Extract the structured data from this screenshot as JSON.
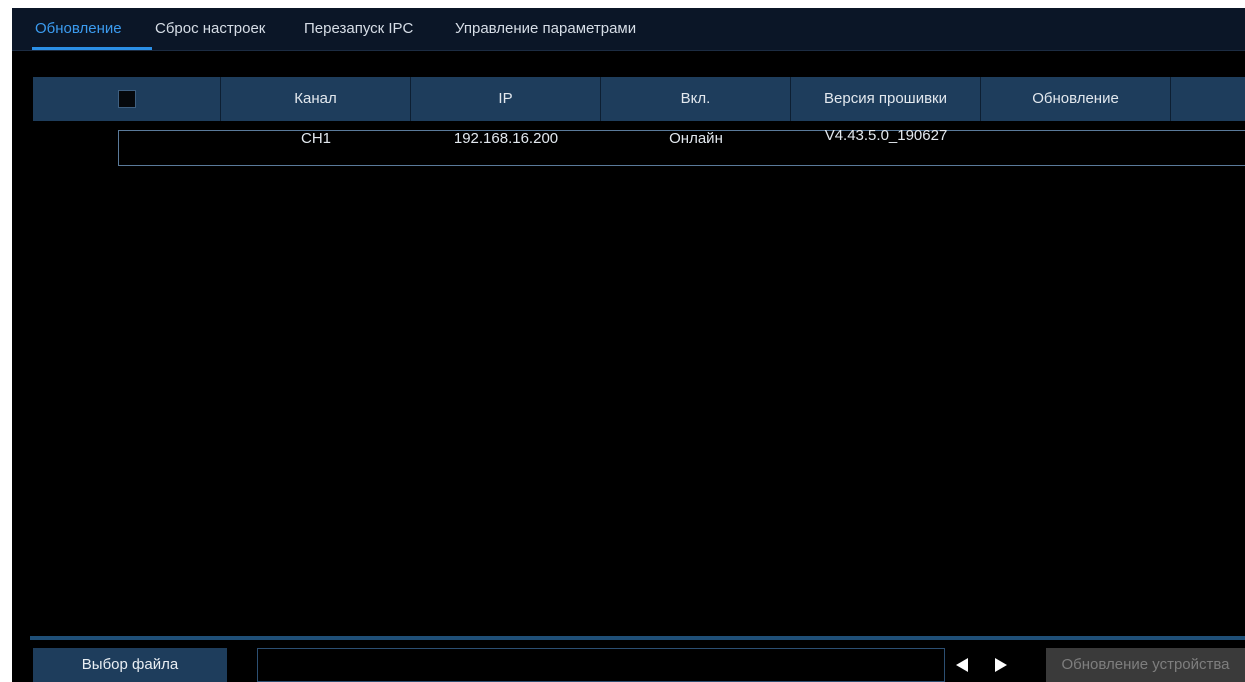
{
  "tabs": [
    {
      "label": "Обновление",
      "active": true
    },
    {
      "label": "Сброс настроек",
      "active": false
    },
    {
      "label": "Перезапуск IPC",
      "active": false
    },
    {
      "label": "Управление параметрами",
      "active": false
    }
  ],
  "table": {
    "columns": [
      "",
      "Канал",
      "IP",
      "Вкл.",
      "Версия прошивки",
      "Обновление",
      ""
    ],
    "rows": [
      {
        "checked": false,
        "channel": "CH1",
        "ip": "192.168.16.200",
        "status": "Онлайн",
        "firmware": "V4.43.5.0_190627",
        "upgrade": ""
      }
    ]
  },
  "footer": {
    "select_file_label": "Выбор файла",
    "file_path_value": "",
    "prev_icon": "triangle-left-icon",
    "next_icon": "triangle-right-icon",
    "upgrade_label": "Обновление устройства"
  },
  "colors": {
    "accent": "#2b8fe6",
    "header_bg": "#1e3d5c",
    "tabbar_bg": "#0b1627",
    "disabled_btn_bg": "#3a3a3a"
  }
}
